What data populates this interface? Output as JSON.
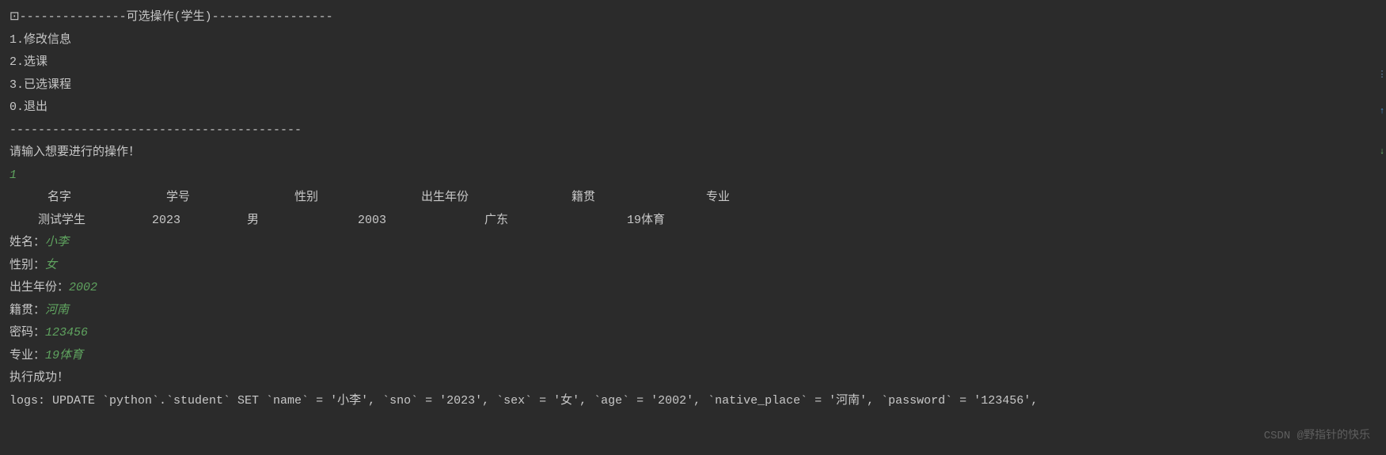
{
  "menu": {
    "header": "⊡---------------可选操作(学生)-----------------",
    "items": [
      "1.修改信息",
      "2.选课",
      "3.已选课程",
      "0.退出"
    ],
    "footer": "-----------------------------------------"
  },
  "prompt": "请输入想要进行的操作！",
  "user_input": "1",
  "table": {
    "headers": {
      "name": "名字",
      "sno": "学号",
      "sex": "性别",
      "birth": "出生年份",
      "native": "籍贯",
      "major": "专业"
    },
    "row": {
      "name": "测试学生",
      "sno": "2023",
      "sex": "男",
      "birth": "2003",
      "native": "广东",
      "major": "19体育"
    }
  },
  "form": {
    "name_label": "姓名：",
    "name_value": "小李",
    "sex_label": "性别：",
    "sex_value": "女",
    "birth_label": "出生年份：",
    "birth_value": "2002",
    "native_label": "籍贯：",
    "native_value": "河南",
    "password_label": "密码：",
    "password_value": "123456",
    "major_label": "专业：",
    "major_value": "19体育"
  },
  "result": "执行成功！",
  "log": "logs: UPDATE `python`.`student` SET `name` = '小李', `sno` = '2023', `sex` = '女', `age` = '2002', `native_place` = '河南', `password` = '123456',",
  "watermark": "CSDN @野指针的快乐"
}
